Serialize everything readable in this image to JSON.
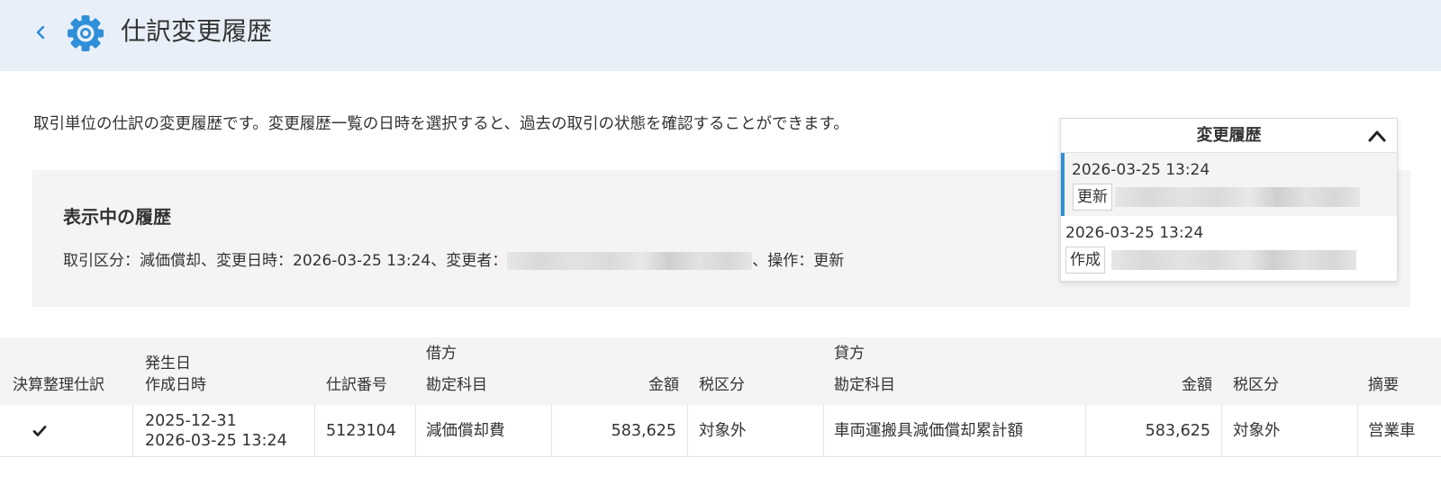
{
  "header": {
    "title": "仕訳変更履歴"
  },
  "description": "取引単位の仕訳の変更履歴です。変更履歴一覧の日時を選択すると、過去の取引の状態を確認することができます。",
  "current": {
    "heading": "表示中の履歴",
    "prefix": "取引区分：減価償却、変更日時：2026-03-25 13:24、変更者：",
    "suffix": "、操作：更新"
  },
  "history": {
    "title": "変更履歴",
    "items": [
      {
        "date": "2026-03-25 13:24",
        "operation": "更新",
        "selected": true
      },
      {
        "date": "2026-03-25 13:24",
        "operation": "作成",
        "selected": false
      }
    ]
  },
  "table": {
    "headers": {
      "adjusting": "決算整理仕訳",
      "occurrence_date": "発生日",
      "created_at": "作成日時",
      "entry_no": "仕訳番号",
      "debit_group": "借方",
      "debit_account": "勘定科目",
      "debit_amount": "金額",
      "debit_tax": "税区分",
      "credit_group": "貸方",
      "credit_account": "勘定科目",
      "credit_amount": "金額",
      "credit_tax": "税区分",
      "memo": "摘要"
    },
    "rows": [
      {
        "adjusting": true,
        "occurrence_date": "2025-12-31",
        "created_at": "2026-03-25 13:24",
        "entry_no": "5123104",
        "debit_account": "減価償却費",
        "debit_amount": "583,625",
        "debit_tax": "対象外",
        "credit_account": "車両運搬具減価償却累計額",
        "credit_amount": "583,625",
        "credit_tax": "対象外",
        "memo": "営業車"
      }
    ]
  },
  "colors": {
    "header_bg": "#e9eff9",
    "icon_blue": "#2f8fd8",
    "panel_bg": "#f5f4f2"
  }
}
